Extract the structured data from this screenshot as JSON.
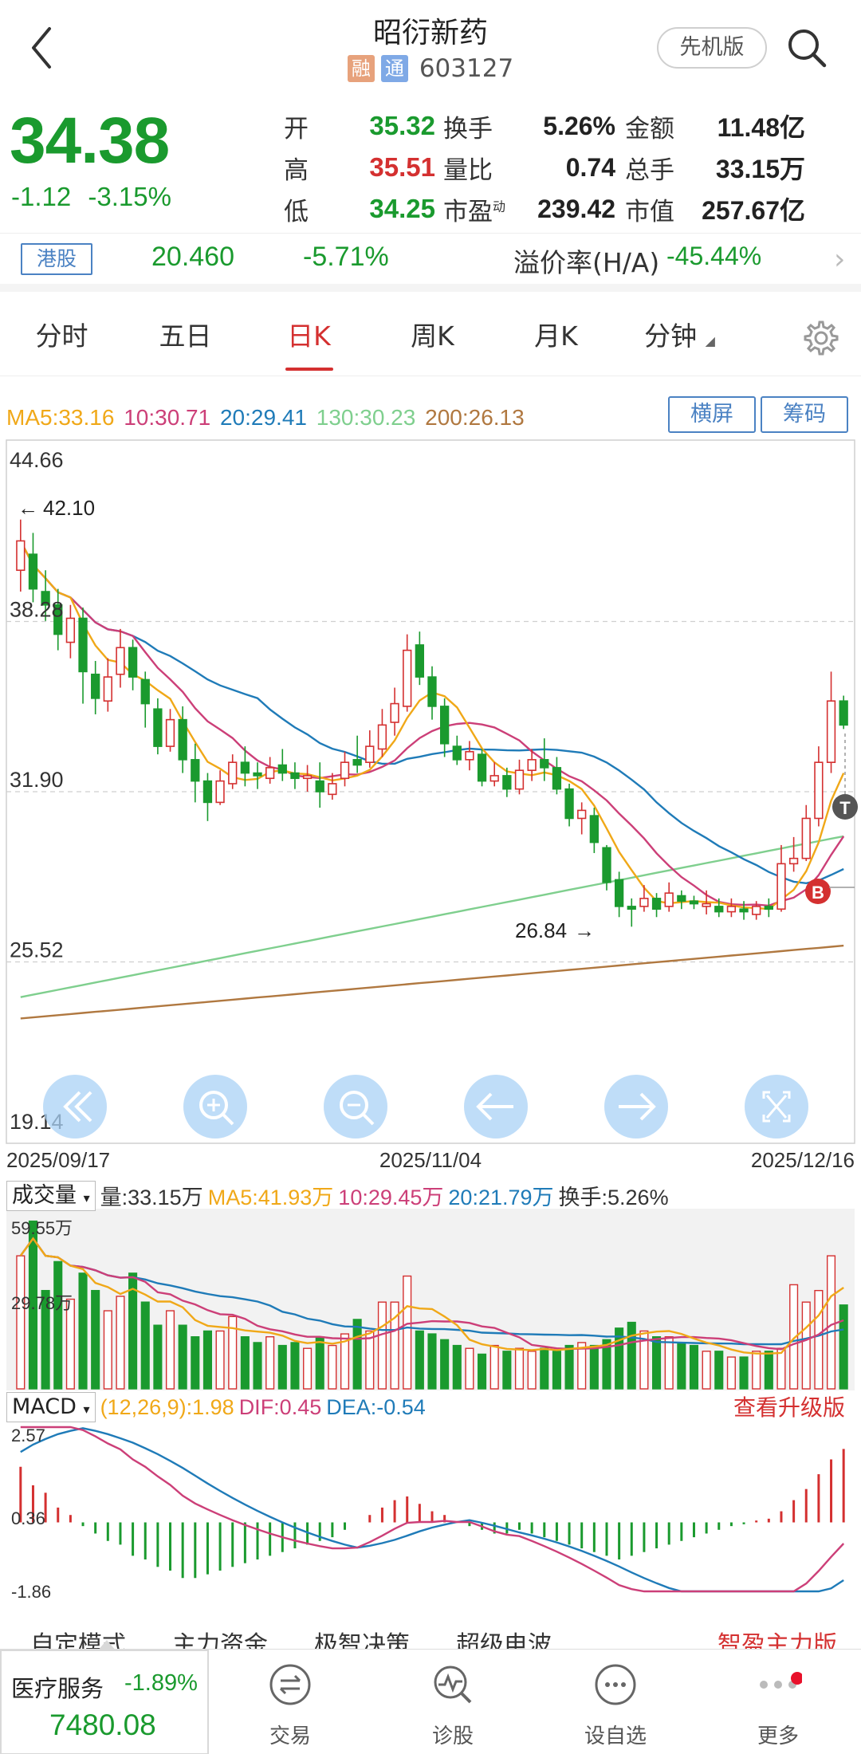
{
  "header": {
    "title": "昭衍新药",
    "tag_rong": "融",
    "tag_tong": "通",
    "code": "603127",
    "mode_button": "先机版",
    "back_icon": "chevron-left-icon",
    "search_icon": "search-icon"
  },
  "quote": {
    "price": "34.38",
    "change": "-1.12",
    "change_pct": "-3.15%",
    "open_label": "开",
    "open": "35.32",
    "high_label": "高",
    "high": "35.51",
    "low_label": "低",
    "low": "34.25",
    "turnover_label": "换手",
    "turnover": "5.26%",
    "vol_ratio_label": "量比",
    "vol_ratio": "0.74",
    "pe_label": "市盈",
    "pe_sup": "动",
    "pe": "239.42",
    "amount_label": "金额",
    "amount": "11.48亿",
    "total_hands_label": "总手",
    "total_hands": "33.15万",
    "mkt_cap_label": "市值",
    "mkt_cap": "257.67亿"
  },
  "hk": {
    "tag": "港股",
    "price": "20.460",
    "pct": "-5.71%",
    "premium_label": "溢价率(H/A)",
    "premium": "-45.44%"
  },
  "tabs": [
    {
      "label": "分时"
    },
    {
      "label": "五日"
    },
    {
      "label": "日K"
    },
    {
      "label": "周K"
    },
    {
      "label": "月K"
    },
    {
      "label": "分钟"
    }
  ],
  "ma": {
    "ma5": "MA5:33.16",
    "ma10": "10:30.71",
    "ma20": "20:29.41",
    "ma130": "130:30.23",
    "ma200": "200:26.13",
    "btn_landscape": "横屏",
    "btn_chips": "筹码"
  },
  "colors": {
    "up": "#d43030",
    "down": "#1a9a2e",
    "ma5": "#f0a818",
    "ma10": "#cc3f78",
    "ma20": "#1f7bb8",
    "ma130": "#7fcf8e",
    "ma200": "#b07840"
  },
  "chart_data": {
    "type": "candlestick",
    "y_axis_labels": [
      "44.66",
      "38.28",
      "31.90",
      "25.52",
      "19.14"
    ],
    "ylim": [
      19.14,
      44.66
    ],
    "x_axis_labels": [
      "2025/09/17",
      "2025/11/04",
      "2025/12/16"
    ],
    "max_marker": "42.10",
    "min_marker": "26.84",
    "buy_marker": "B",
    "t_marker": "T",
    "candles": [
      [
        40.2,
        41.3,
        42.1,
        39.4
      ],
      [
        40.8,
        39.5,
        41.6,
        39.0
      ],
      [
        39.4,
        38.9,
        40.2,
        38.3
      ],
      [
        38.9,
        37.8,
        39.5,
        37.2
      ],
      [
        37.5,
        38.4,
        38.9,
        36.9
      ],
      [
        38.4,
        36.4,
        38.8,
        35.2
      ],
      [
        36.3,
        35.4,
        36.8,
        34.8
      ],
      [
        35.3,
        36.2,
        36.9,
        34.9
      ],
      [
        36.3,
        37.3,
        38.0,
        35.8
      ],
      [
        37.3,
        36.2,
        37.6,
        35.7
      ],
      [
        36.1,
        35.2,
        36.4,
        34.3
      ],
      [
        35.0,
        33.6,
        35.4,
        33.3
      ],
      [
        33.6,
        34.6,
        35.0,
        33.4
      ],
      [
        34.6,
        33.1,
        35.1,
        32.6
      ],
      [
        33.1,
        32.3,
        33.7,
        31.5
      ],
      [
        32.3,
        31.5,
        32.6,
        30.8
      ],
      [
        31.5,
        32.3,
        32.7,
        31.4
      ],
      [
        32.2,
        33.0,
        33.3,
        32.0
      ],
      [
        33.0,
        32.6,
        33.6,
        32.1
      ],
      [
        32.6,
        32.5,
        33.0,
        32.0
      ],
      [
        32.4,
        32.8,
        33.2,
        32.2
      ],
      [
        32.9,
        32.6,
        33.5,
        32.3
      ],
      [
        32.6,
        32.4,
        33.0,
        32.0
      ],
      [
        32.4,
        32.5,
        32.9,
        31.9
      ],
      [
        32.3,
        31.9,
        33.0,
        31.3
      ],
      [
        31.8,
        32.2,
        32.6,
        31.6
      ],
      [
        32.4,
        33.0,
        33.4,
        32.1
      ],
      [
        33.1,
        32.9,
        34.0,
        32.6
      ],
      [
        33.0,
        33.6,
        34.2,
        32.8
      ],
      [
        33.5,
        34.4,
        35.0,
        33.2
      ],
      [
        34.5,
        35.2,
        35.8,
        34.0
      ],
      [
        35.1,
        37.2,
        37.8,
        34.9
      ],
      [
        37.4,
        36.2,
        37.9,
        35.9
      ],
      [
        36.2,
        35.1,
        36.6,
        34.6
      ],
      [
        35.1,
        33.7,
        35.4,
        33.2
      ],
      [
        33.6,
        33.1,
        34.0,
        32.9
      ],
      [
        33.1,
        33.4,
        33.8,
        32.7
      ],
      [
        33.3,
        32.3,
        33.5,
        32.1
      ],
      [
        32.3,
        32.5,
        33.0,
        32.1
      ],
      [
        32.5,
        32.0,
        32.8,
        31.7
      ],
      [
        32.0,
        32.7,
        33.1,
        31.8
      ],
      [
        32.7,
        33.1,
        33.5,
        32.3
      ],
      [
        33.1,
        32.8,
        33.9,
        32.3
      ],
      [
        32.8,
        32.0,
        33.2,
        31.8
      ],
      [
        32.0,
        30.9,
        32.2,
        30.6
      ],
      [
        30.9,
        31.2,
        31.5,
        30.3
      ],
      [
        31.0,
        30.0,
        31.3,
        29.6
      ],
      [
        29.8,
        28.5,
        29.9,
        28.2
      ],
      [
        28.6,
        27.6,
        28.9,
        27.2
      ],
      [
        27.6,
        27.5,
        27.9,
        26.84
      ],
      [
        27.6,
        27.9,
        28.4,
        27.4
      ],
      [
        27.9,
        27.5,
        28.1,
        27.2
      ],
      [
        27.6,
        28.1,
        28.5,
        27.4
      ],
      [
        28.0,
        27.8,
        28.2,
        27.5
      ],
      [
        27.8,
        27.7,
        28.0,
        27.5
      ],
      [
        27.6,
        27.7,
        28.2,
        27.3
      ],
      [
        27.6,
        27.4,
        27.9,
        27.2
      ],
      [
        27.4,
        27.6,
        27.9,
        27.2
      ],
      [
        27.5,
        27.4,
        27.8,
        27.1
      ],
      [
        27.3,
        27.6,
        27.8,
        27.1
      ],
      [
        27.6,
        27.5,
        27.9,
        27.2
      ],
      [
        27.5,
        29.2,
        29.9,
        27.4
      ],
      [
        29.2,
        29.4,
        30.2,
        28.9
      ],
      [
        29.4,
        30.9,
        31.4,
        29.3
      ],
      [
        30.9,
        33.0,
        33.6,
        30.6
      ],
      [
        33.0,
        35.3,
        36.4,
        32.6
      ],
      [
        35.3,
        34.4,
        35.5,
        34.25
      ]
    ],
    "volume_header": {
      "selector": "成交量",
      "total": "量:33.15万",
      "ma5": "MA5:41.93万",
      "ma10": "10:29.45万",
      "ma20": "20:21.79万",
      "turnover": "换手:5.26%",
      "y_top": "59.55万",
      "y_mid": "29.78万"
    },
    "volumes": [
      46,
      58,
      34,
      44,
      31,
      40,
      34,
      27,
      32,
      40,
      30,
      22,
      27,
      22,
      18,
      20,
      20,
      25,
      18,
      16,
      18,
      15,
      16,
      14,
      18,
      15,
      19,
      24,
      20,
      30,
      30,
      39,
      20,
      19,
      17,
      15,
      14,
      12,
      15,
      13,
      14,
      13,
      14,
      13,
      15,
      16,
      15,
      17,
      21,
      23,
      20,
      18,
      18,
      16,
      15,
      13,
      13,
      11,
      11,
      13,
      13,
      14,
      36,
      30,
      34,
      46,
      29
    ],
    "macd_header": {
      "selector": "MACD",
      "params": "(12,26,9):1.98",
      "dif": "DIF:0.45",
      "dea": "DEA:-0.54",
      "upgrade": "查看升级版",
      "y_top": "2.57",
      "y_mid": "0.36",
      "y_bottom": "-1.86"
    },
    "macd_hist": [
      1.5,
      1.0,
      0.8,
      0.4,
      0.2,
      -0.1,
      -0.3,
      -0.5,
      -0.6,
      -0.9,
      -1.0,
      -1.2,
      -1.3,
      -1.5,
      -1.5,
      -1.4,
      -1.3,
      -1.2,
      -1.1,
      -1.0,
      -0.9,
      -0.8,
      -0.7,
      -0.6,
      -0.5,
      -0.4,
      -0.2,
      0.0,
      0.2,
      0.4,
      0.6,
      0.7,
      0.5,
      0.3,
      0.2,
      0.0,
      -0.1,
      -0.2,
      -0.3,
      -0.3,
      -0.2,
      -0.3,
      -0.4,
      -0.5,
      -0.6,
      -0.7,
      -0.8,
      -0.9,
      -1.0,
      -0.9,
      -0.8,
      -0.7,
      -0.6,
      -0.5,
      -0.4,
      -0.3,
      -0.2,
      -0.1,
      -0.05,
      0.05,
      0.1,
      0.3,
      0.6,
      0.9,
      1.3,
      1.7,
      1.98
    ]
  },
  "mode_tabs": [
    "自定模式",
    "主力资金",
    "极智决策",
    "超级电波",
    "智盈主力版"
  ],
  "bottom": {
    "sector_name": "医疗服务",
    "sector_pct": "-1.89%",
    "sector_value": "7480.08",
    "nav": [
      {
        "label": "交易",
        "icon": "trade-icon"
      },
      {
        "label": "诊股",
        "icon": "diagnose-icon"
      },
      {
        "label": "设自选",
        "icon": "add-watchlist-icon"
      },
      {
        "label": "更多",
        "icon": "more-icon"
      }
    ]
  }
}
